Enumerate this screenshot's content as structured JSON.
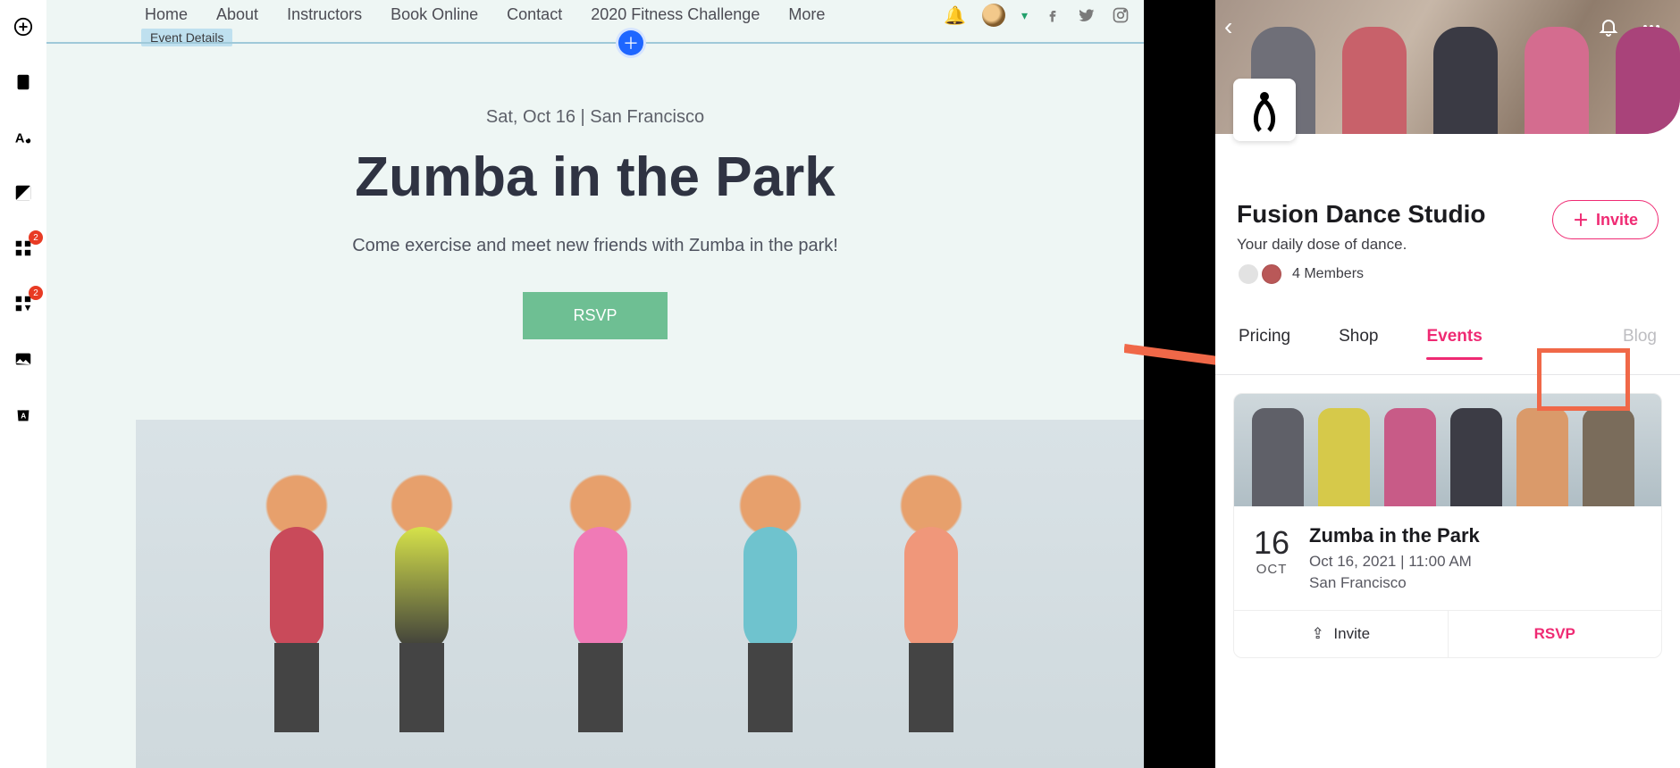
{
  "editor_toolbar": {
    "items": [
      {
        "name": "add-icon"
      },
      {
        "name": "pages-icon"
      },
      {
        "name": "design-icon"
      },
      {
        "name": "media-icon"
      },
      {
        "name": "apps-icon",
        "badge": "2"
      },
      {
        "name": "app-market-icon",
        "badge": "2"
      },
      {
        "name": "image-icon"
      },
      {
        "name": "store-icon"
      }
    ]
  },
  "site": {
    "nav": [
      "Home",
      "About",
      "Instructors",
      "Book Online",
      "Contact",
      "2020 Fitness Challenge",
      "More"
    ],
    "sub_tab": "Event Details",
    "event": {
      "date_location": "Sat, Oct 16  |  San Francisco",
      "title": "Zumba in the Park",
      "description": "Come exercise and meet new friends with Zumba in the park!",
      "rsvp_label": "RSVP"
    }
  },
  "mobile": {
    "studio": {
      "name": "Fusion Dance Studio",
      "tagline": "Your daily dose of dance.",
      "members_label": "4 Members",
      "invite_label": "Invite"
    },
    "tabs": [
      "Pricing",
      "Shop",
      "Events",
      "Blog"
    ],
    "active_tab": "Events",
    "event_card": {
      "day": "16",
      "month": "OCT",
      "title": "Zumba in the Park",
      "datetime": "Oct 16, 2021 | 11:00 AM",
      "location": "San Francisco",
      "invite_label": "Invite",
      "rsvp_label": "RSVP"
    }
  }
}
